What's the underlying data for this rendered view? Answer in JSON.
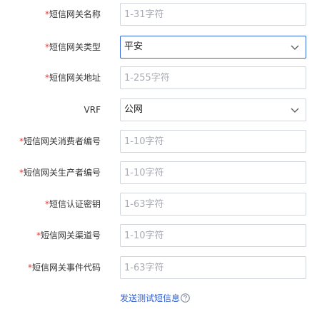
{
  "form": {
    "gateway_name": {
      "label": "短信网关名称",
      "placeholder": "1-31字符",
      "value": ""
    },
    "gateway_type": {
      "label": "短信网关类型",
      "value": "平安"
    },
    "gateway_address": {
      "label": "短信网关地址",
      "placeholder": "1-255字符",
      "value": ""
    },
    "vrf": {
      "label": "VRF",
      "value": "公网"
    },
    "consumer_id": {
      "label": "短信网关消费者编号",
      "placeholder": "1-10字符",
      "value": ""
    },
    "producer_id": {
      "label": "短信网关生产者编号",
      "placeholder": "1-10字符",
      "value": ""
    },
    "auth_key": {
      "label": "短信认证密钥",
      "placeholder": "1-63字符",
      "value": ""
    },
    "channel_id": {
      "label": "短信网关渠道号",
      "placeholder": "1-10字符",
      "value": ""
    },
    "event_code": {
      "label": "短信网关事件代码",
      "placeholder": "1-63字符",
      "value": ""
    },
    "required_mark": "*",
    "send_test_link": "发送测试短信息",
    "help_icon": "question-circle-icon"
  },
  "colors": {
    "required": "#e53935",
    "link": "#2f5fd0",
    "focus_border": "#3366dd",
    "border": "#d0d4db"
  }
}
